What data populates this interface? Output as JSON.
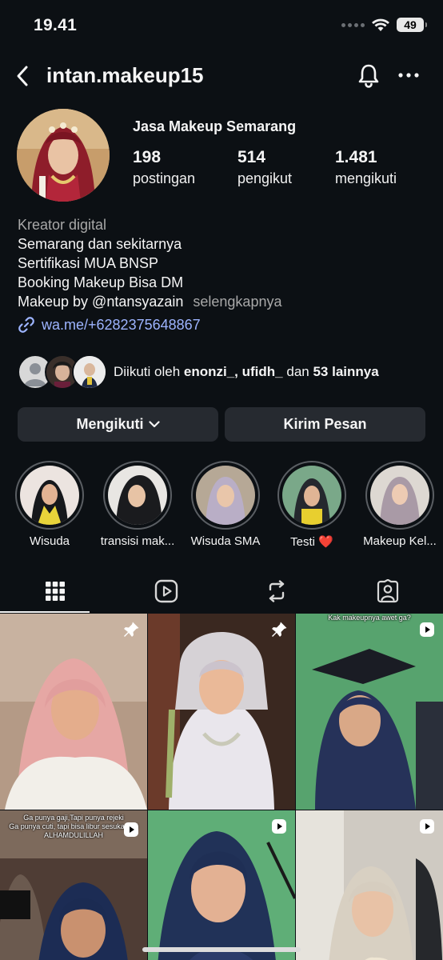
{
  "status_bar": {
    "time": "19.41",
    "battery": "49"
  },
  "header": {
    "username": "intan.makeup15"
  },
  "profile": {
    "name": "Jasa Makeup Semarang",
    "stats": [
      {
        "value": "198",
        "label": "postingan"
      },
      {
        "value": "514",
        "label": "pengikut"
      },
      {
        "value": "1.481",
        "label": "mengikuti"
      }
    ],
    "category": "Kreator digital",
    "bio_lines": [
      "Semarang dan sekitarnya",
      "Sertifikasi MUA BNSP",
      "Booking Makeup Bisa DM",
      "Makeup by @ntansyazain"
    ],
    "more_label": "selengkapnya",
    "link": "wa.me/+6282375648867"
  },
  "followed_by": {
    "prefix": "Diikuti oleh",
    "names": "enonzi_, ufidh_",
    "conjunction": "dan",
    "others": "53 lainnya"
  },
  "actions": {
    "follow_label": "Mengikuti",
    "message_label": "Kirim Pesan"
  },
  "highlights": [
    {
      "label": "Wisuda"
    },
    {
      "label": "transisi mak..."
    },
    {
      "label": "Wisuda SMA"
    },
    {
      "label": "Testi ❤️"
    },
    {
      "label": "Makeup Kel..."
    }
  ],
  "tabs": [
    "posts-grid",
    "reels",
    "reposts",
    "tagged"
  ],
  "grid": {
    "captions": {
      "post3": "Kak makeupnya awet ga?",
      "post4_line1": "Ga punya gaji,Tapi punya rejeki",
      "post4_line2": "Ga punya cuti, tapi bisa libur sesuka hati",
      "post4_line3": "ALHAMDULILLAH"
    }
  },
  "colors": {
    "background": "#0c1014",
    "button": "#262a30",
    "link": "#9db4ff",
    "muted": "#a8a8a8"
  }
}
